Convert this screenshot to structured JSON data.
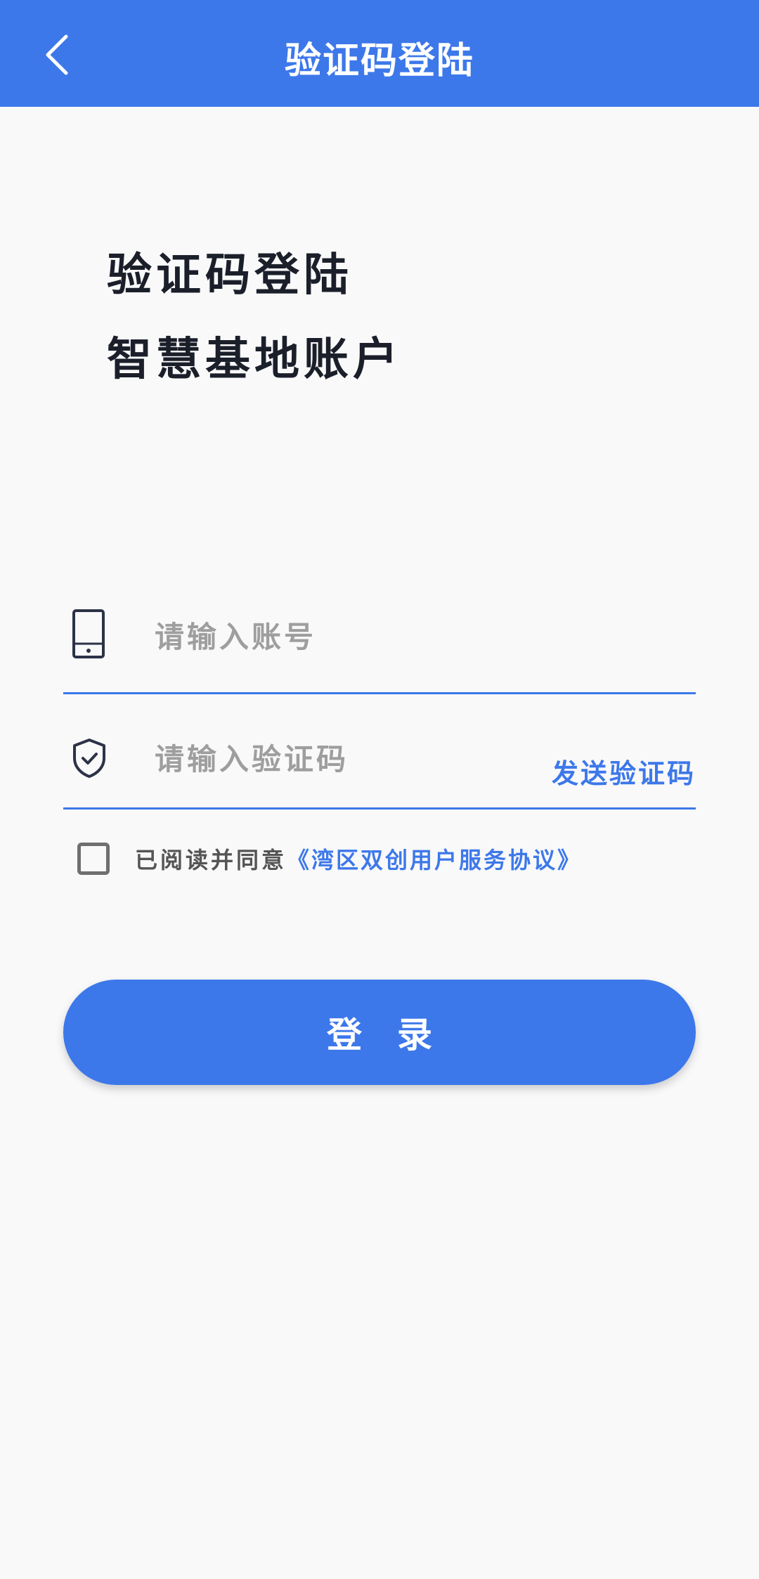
{
  "topbar": {
    "title": "验证码登陆",
    "back_icon": "chevron-left-icon"
  },
  "intro": {
    "line1": "验证码登陆",
    "line2": "智慧基地账户"
  },
  "account": {
    "icon": "phone-icon",
    "placeholder": "请输入账号",
    "value": ""
  },
  "code": {
    "icon": "shield-check-icon",
    "placeholder": "请输入验证码",
    "value": "",
    "send_label": "发送验证码"
  },
  "agreement": {
    "checked": false,
    "prefix": "已阅读并同意",
    "link": "《湾区双创用户服务协议》"
  },
  "login": {
    "label": "登　录"
  },
  "colors": {
    "primary": "#3d78ea",
    "background": "#f9f9fa",
    "heading": "#1b1f2a"
  }
}
